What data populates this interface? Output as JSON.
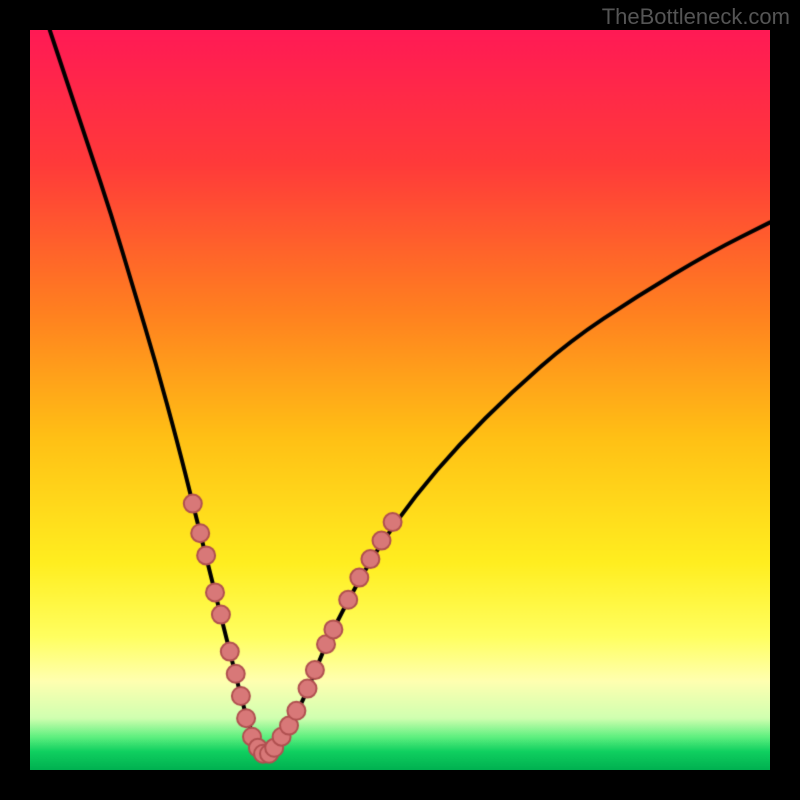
{
  "watermark": "TheBottleneck.com",
  "colors": {
    "top": "#ff2050",
    "upper_mid": "#ff5030",
    "mid": "#ffc020",
    "lower_mid": "#ffff40",
    "pale": "#ffffc0",
    "green": "#10e060",
    "black_frame": "#000000",
    "curve": "#000000",
    "dot_fill": "#d87878",
    "dot_stroke": "#b05050"
  },
  "chart_data": {
    "type": "line",
    "title": "",
    "xlabel": "",
    "ylabel": "",
    "xlim": [
      0,
      100
    ],
    "ylim": [
      0,
      100
    ],
    "legend": [],
    "annotations": [],
    "series": [
      {
        "name": "curve",
        "x": [
          2,
          5,
          8,
          11,
          14,
          17,
          20,
          22,
          24,
          25.5,
          27,
          28,
          29,
          30,
          31,
          32,
          33,
          34,
          36,
          38,
          40,
          43,
          47,
          52,
          58,
          65,
          73,
          82,
          92,
          100
        ],
        "y": [
          102,
          93,
          84,
          75,
          65,
          55,
          44,
          36,
          28,
          22,
          16,
          12,
          8,
          5,
          3,
          2,
          2.5,
          4,
          7.5,
          12,
          17,
          23,
          30,
          37,
          44,
          51,
          58,
          64,
          70,
          74
        ]
      }
    ],
    "dots": [
      {
        "x": 22.0,
        "y": 36
      },
      {
        "x": 23.0,
        "y": 32
      },
      {
        "x": 23.8,
        "y": 29
      },
      {
        "x": 25.0,
        "y": 24
      },
      {
        "x": 25.8,
        "y": 21
      },
      {
        "x": 27.0,
        "y": 16
      },
      {
        "x": 27.8,
        "y": 13
      },
      {
        "x": 28.5,
        "y": 10
      },
      {
        "x": 29.2,
        "y": 7
      },
      {
        "x": 30.0,
        "y": 4.5
      },
      {
        "x": 30.8,
        "y": 3
      },
      {
        "x": 31.5,
        "y": 2.2
      },
      {
        "x": 32.3,
        "y": 2.2
      },
      {
        "x": 33.0,
        "y": 3
      },
      {
        "x": 34.0,
        "y": 4.5
      },
      {
        "x": 35.0,
        "y": 6
      },
      {
        "x": 36.0,
        "y": 8
      },
      {
        "x": 37.5,
        "y": 11
      },
      {
        "x": 38.5,
        "y": 13.5
      },
      {
        "x": 40.0,
        "y": 17
      },
      {
        "x": 41.0,
        "y": 19
      },
      {
        "x": 43.0,
        "y": 23
      },
      {
        "x": 44.5,
        "y": 26
      },
      {
        "x": 46.0,
        "y": 28.5
      },
      {
        "x": 47.5,
        "y": 31
      },
      {
        "x": 49.0,
        "y": 33.5
      }
    ],
    "gradient_stops": [
      {
        "offset": 0.0,
        "color": "#ff1a55"
      },
      {
        "offset": 0.18,
        "color": "#ff3a3a"
      },
      {
        "offset": 0.38,
        "color": "#ff8020"
      },
      {
        "offset": 0.55,
        "color": "#ffc015"
      },
      {
        "offset": 0.72,
        "color": "#ffee20"
      },
      {
        "offset": 0.82,
        "color": "#ffff60"
      },
      {
        "offset": 0.88,
        "color": "#ffffb0"
      },
      {
        "offset": 0.93,
        "color": "#d0ffb0"
      },
      {
        "offset": 0.955,
        "color": "#60f080"
      },
      {
        "offset": 0.975,
        "color": "#10d060"
      },
      {
        "offset": 1.0,
        "color": "#00b050"
      }
    ]
  }
}
